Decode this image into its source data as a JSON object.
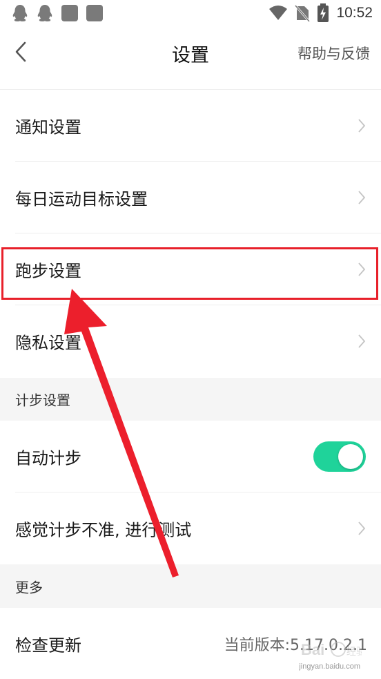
{
  "status_bar": {
    "time": "10:52",
    "icons_left": [
      "qq-icon",
      "qq-icon",
      "app-square-icon",
      "app-square-icon"
    ],
    "icons_right": [
      "wifi-icon",
      "no-sim-icon",
      "battery-charging-icon"
    ]
  },
  "nav": {
    "title": "设置",
    "help": "帮助与反馈"
  },
  "rows": [
    {
      "label": "通知设置"
    },
    {
      "label": "每日运动目标设置"
    },
    {
      "label": "跑步设置"
    },
    {
      "label": "隐私设置"
    }
  ],
  "sections": {
    "step": "计步设置",
    "more": "更多"
  },
  "step_rows": {
    "auto_step": "自动计步",
    "auto_step_enabled": true,
    "calibrate": "感觉计步不准, 进行测试"
  },
  "more_rows": {
    "check_update": "检查更新",
    "version": "当前版本:5.17.0.2.1"
  },
  "watermark": {
    "url": "jingyan.baidu.com"
  },
  "colors": {
    "toggle_on": "#1fd39a",
    "highlight": "#e8202a",
    "section_bg": "#f5f5f5"
  }
}
